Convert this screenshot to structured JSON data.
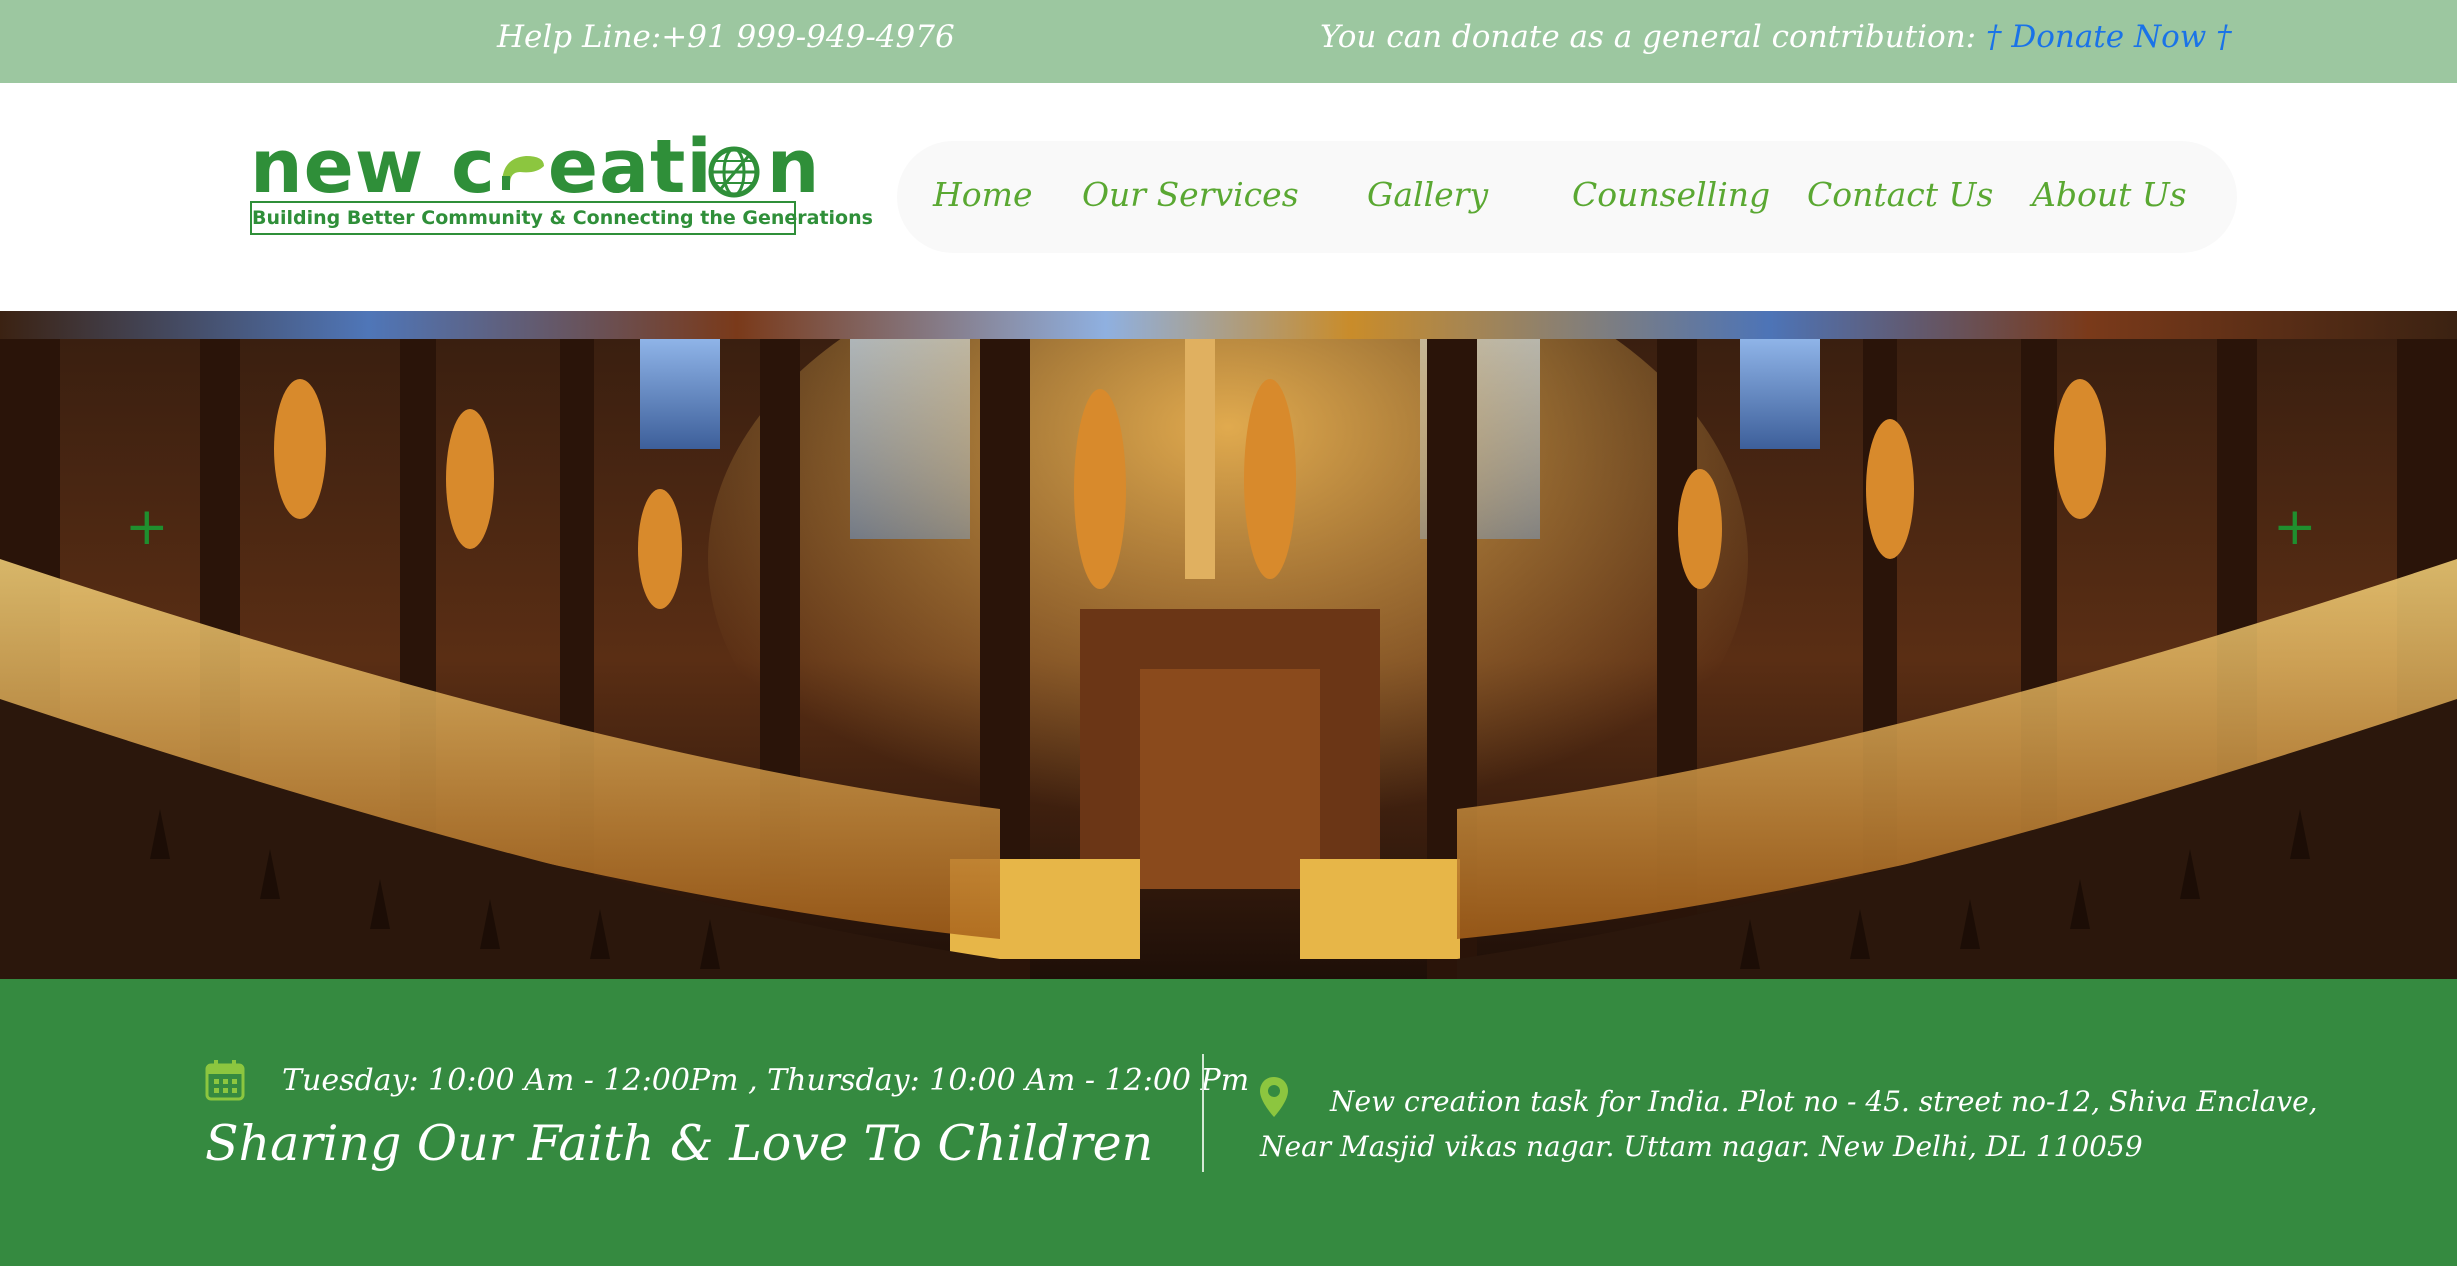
{
  "topbar": {
    "helpline": "Help Line:+91 999-949-4976",
    "donate_prefix": "You can donate as a general contribution:",
    "donate_link": "† Donate Now †",
    "bg_color": "#9cc7a0",
    "link_color": "#1a73e8"
  },
  "logo": {
    "word_a": "new c",
    "word_b": "eati",
    "word_c": "n",
    "tagline": "Building Better Community & Connecting the Generations",
    "icons": [
      "sprout-icon",
      "globe-icon"
    ],
    "brand_color": "#2f8f39"
  },
  "nav": {
    "items": [
      {
        "label": "Home"
      },
      {
        "label": "Our Services"
      },
      {
        "label": "Gallery"
      },
      {
        "label": "Counselling"
      },
      {
        "label": "Contact Us"
      },
      {
        "label": "About Us"
      }
    ],
    "text_color": "#5aa832"
  },
  "hero": {
    "arrows": {
      "prev": "+",
      "next": "+"
    },
    "arrow_color": "#1f8f2e"
  },
  "info": {
    "schedule": "Tuesday: 10:00 Am - 12:00Pm , Thursday: 10:00 Am - 12:00 Pm",
    "tagline": "Sharing Our Faith & Love To Children",
    "address_line1": "New creation task for India. Plot no - 45. street no-12, Shiva Enclave,",
    "address_line2": "Near Masjid vikas nagar. Uttam nagar. New Delhi, DL 110059",
    "icons": [
      "calendar-icon",
      "location-pin-icon"
    ],
    "bg_color": "#358a40"
  }
}
